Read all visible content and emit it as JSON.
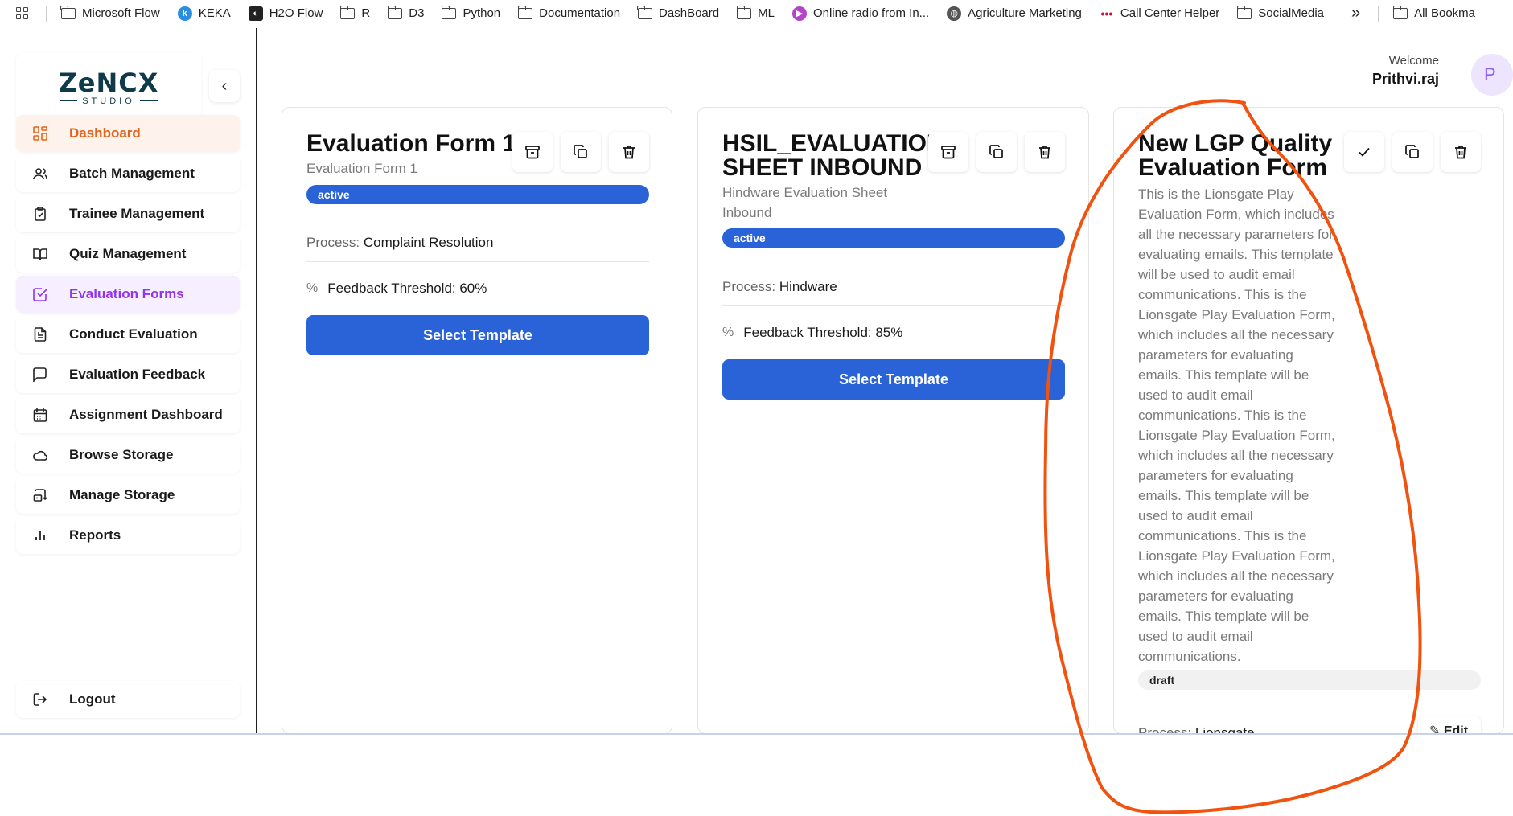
{
  "bookmarks": [
    {
      "label": "Microsoft Flow",
      "icon": "folder-icon"
    },
    {
      "label": "KEKA",
      "icon": "keka-icon"
    },
    {
      "label": "H2O Flow",
      "icon": "h2o-icon"
    },
    {
      "label": "R",
      "icon": "folder-icon"
    },
    {
      "label": "D3",
      "icon": "folder-icon"
    },
    {
      "label": "Python",
      "icon": "folder-icon"
    },
    {
      "label": "Documentation",
      "icon": "folder-icon"
    },
    {
      "label": "DashBoard",
      "icon": "folder-icon"
    },
    {
      "label": "ML",
      "icon": "folder-icon"
    },
    {
      "label": "Online radio from In...",
      "icon": "radio-icon"
    },
    {
      "label": "Agriculture Marketing",
      "icon": "globe-icon"
    },
    {
      "label": "Call Center Helper",
      "icon": "dots-icon"
    },
    {
      "label": "SocialMedia",
      "icon": "folder-icon"
    }
  ],
  "bookmarks_more": "»",
  "bookmarks_all": "All Bookma",
  "logo": {
    "main": "ZeNCX",
    "sub": "STUDIO"
  },
  "collapse_icon": "‹",
  "sidebar": {
    "items": [
      {
        "label": "Dashboard",
        "icon": "dashboard-icon"
      },
      {
        "label": "Batch Management",
        "icon": "users-icon"
      },
      {
        "label": "Trainee Management",
        "icon": "clipboard-icon"
      },
      {
        "label": "Quiz Management",
        "icon": "book-icon"
      },
      {
        "label": "Evaluation Forms",
        "icon": "check-square-icon"
      },
      {
        "label": "Conduct Evaluation",
        "icon": "document-icon"
      },
      {
        "label": "Evaluation Feedback",
        "icon": "message-icon"
      },
      {
        "label": "Assignment Dashboard",
        "icon": "calendar-icon"
      },
      {
        "label": "Browse Storage",
        "icon": "cloud-icon"
      },
      {
        "label": "Manage Storage",
        "icon": "storage-icon"
      },
      {
        "label": "Reports",
        "icon": "bar-chart-icon"
      }
    ],
    "logout": "Logout"
  },
  "header": {
    "welcome": "Welcome",
    "user": "Prithvi.raj",
    "avatar_initial": "P"
  },
  "cards": [
    {
      "title": "Evaluation Form 1",
      "subtitle": "Evaluation Form 1",
      "status": "active",
      "process_label": "Process:",
      "process_value": "Complaint Resolution",
      "threshold_icon": "%",
      "threshold": "Feedback Threshold: 60%",
      "button": "Select Template"
    },
    {
      "title_line1": "HSIL_EVALUATION",
      "title_line2": "SHEET INBOUND",
      "subtitle_line1": "Hindware Evaluation Sheet",
      "subtitle_line2": "Inbound",
      "status": "active",
      "process_label": "Process:",
      "process_value": "Hindware",
      "threshold_icon": "%",
      "threshold": "Feedback Threshold: 85%",
      "button": "Select Template"
    },
    {
      "title_line1": "New LGP Quality",
      "title_line2": "Evaluation Form",
      "description": "This is the Lionsgate Play Evaluation Form, which includes all the necessary parameters for evaluating emails. This template will be used to audit email communications. This is the Lionsgate Play Evaluation Form, which includes all the necessary parameters for evaluating emails. This template will be used to audit email communications. This is the Lionsgate Play Evaluation Form, which includes all the necessary parameters for evaluating emails. This template will be used to audit email communications. This is the Lionsgate Play Evaluation Form, which includes all the necessary parameters for evaluating emails. This template will be used to audit email communications.",
      "status": "draft",
      "process_label": "Process:",
      "process_value": "Lionsgate",
      "edit": "Edit"
    }
  ],
  "colors": {
    "primary": "#2a62d8",
    "dashboard_accent": "#e0641c",
    "active_nav": "#9333ea",
    "annotation": "#f0520f"
  }
}
